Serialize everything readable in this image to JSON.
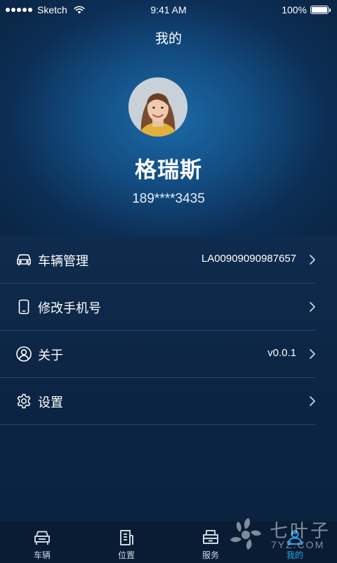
{
  "status_bar": {
    "carrier": "Sketch",
    "time": "9:41 AM",
    "battery": "100%"
  },
  "header": {
    "title": "我的"
  },
  "profile": {
    "name": "格瑞斯",
    "phone": "189****3435"
  },
  "menu": {
    "items": [
      {
        "label": "车辆管理",
        "value": "LA00909090987657",
        "icon": "car-icon"
      },
      {
        "label": "修改手机号",
        "value": "",
        "icon": "phone-icon"
      },
      {
        "label": "关于",
        "value": "v0.0.1",
        "icon": "user-circle-icon"
      },
      {
        "label": "设置",
        "value": "",
        "icon": "gear-icon"
      }
    ]
  },
  "tabbar": {
    "tabs": [
      {
        "label": "车辆",
        "icon": "car-front-icon"
      },
      {
        "label": "位置",
        "icon": "building-icon"
      },
      {
        "label": "服务",
        "icon": "service-icon"
      },
      {
        "label": "我的",
        "icon": "profile-icon"
      }
    ],
    "active_color": "#2aa6e8"
  },
  "watermark": {
    "brand": "七叶子",
    "sub": "7YZ.COM"
  },
  "colors": {
    "background": "#0c2340",
    "hero_center": "#1b6aa8",
    "tabbar": "#0a1c33",
    "divider": "#4a6e92"
  }
}
